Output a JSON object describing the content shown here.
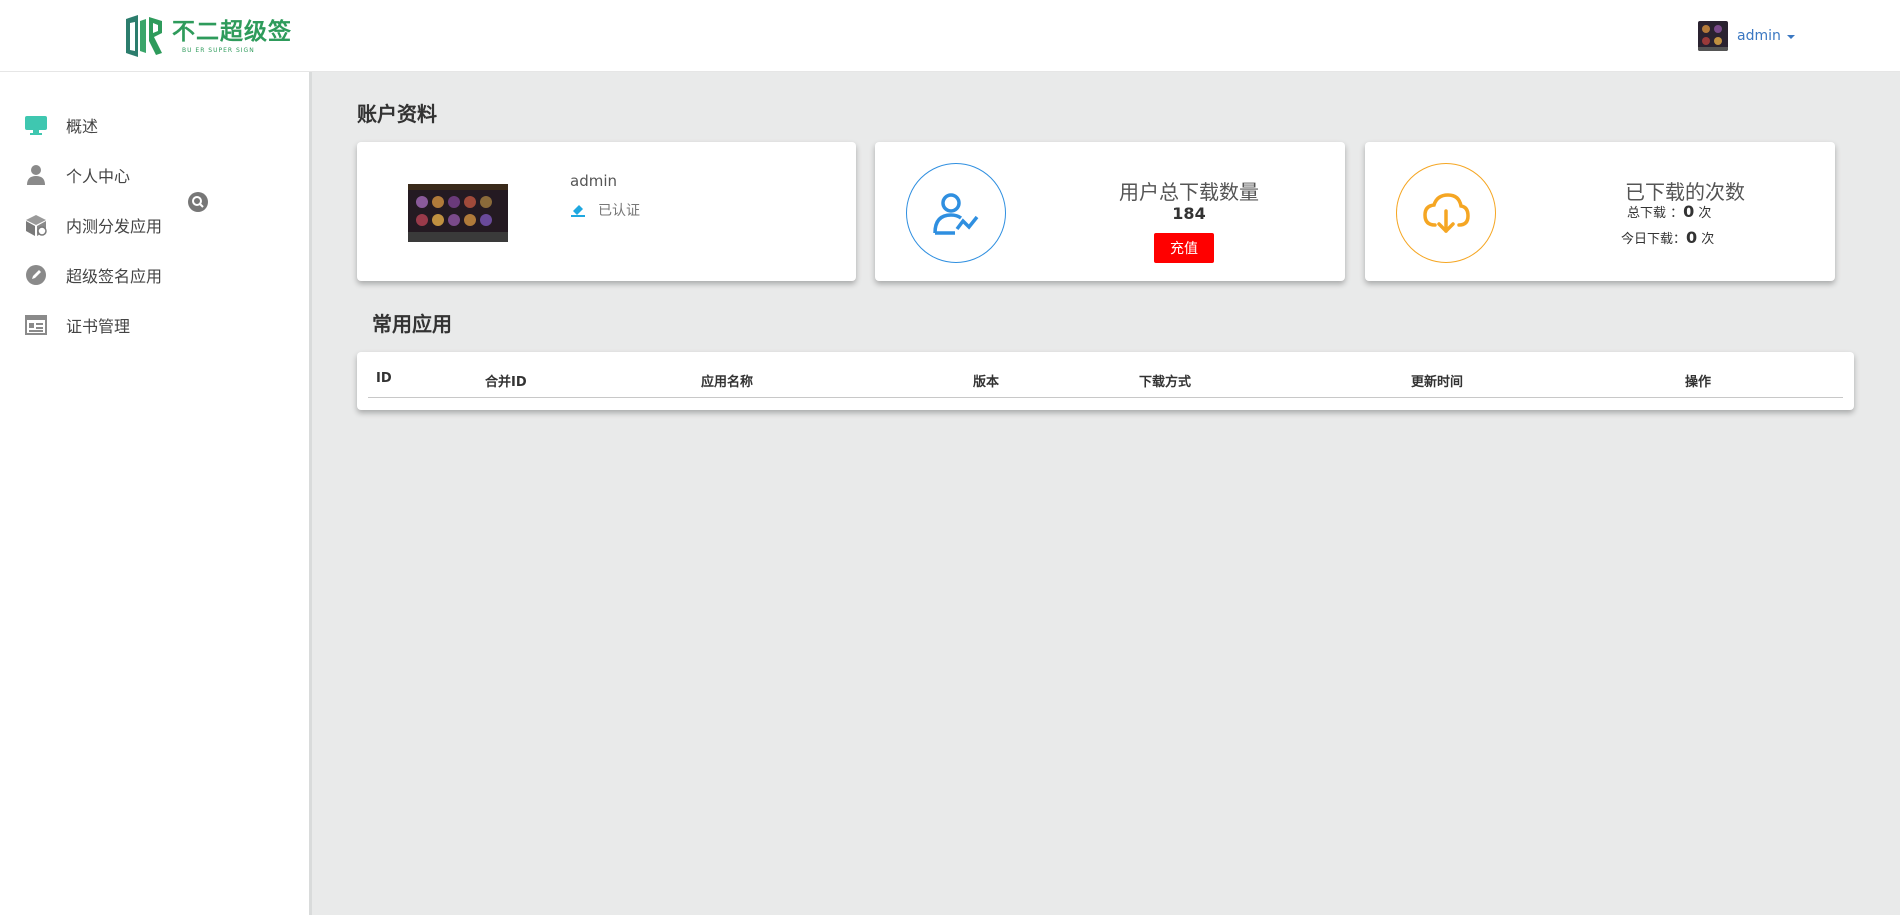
{
  "header": {
    "logo_title": "不二超级签",
    "logo_subtitle": "BU ER SUPER SIGN",
    "user_name": "admin"
  },
  "sidebar": {
    "items": [
      {
        "label": "概述",
        "icon": "monitor-icon"
      },
      {
        "label": "个人中心",
        "icon": "person-icon"
      },
      {
        "label": "内测分发应用",
        "icon": "package-icon"
      },
      {
        "label": "超级签名应用",
        "icon": "pencil-icon"
      },
      {
        "label": "证书管理",
        "icon": "certificate-icon"
      }
    ]
  },
  "account": {
    "section_title": "账户资料",
    "name": "admin",
    "verify_status": "已认证"
  },
  "downloads_total": {
    "title": "用户总下载数量",
    "value": "184",
    "recharge_label": "充值"
  },
  "downloaded": {
    "title": "已下载的次数",
    "total_label": "总下载 ：",
    "total_value": "0",
    "total_unit": "次",
    "today_label": "今日下载：",
    "today_value": "0",
    "today_unit": "次"
  },
  "apps": {
    "section_title": "常用应用",
    "columns": [
      "ID",
      "合并ID",
      "应用名称",
      "版本",
      "下载方式",
      "更新时间",
      "操作"
    ]
  },
  "colors": {
    "brand_green": "#2e9b5b",
    "accent_teal": "#3fc7b0",
    "circle_blue": "#2f8fe0",
    "circle_orange": "#f5a623",
    "recharge_red": "#ff0000",
    "link_blue": "#3b78c2"
  }
}
